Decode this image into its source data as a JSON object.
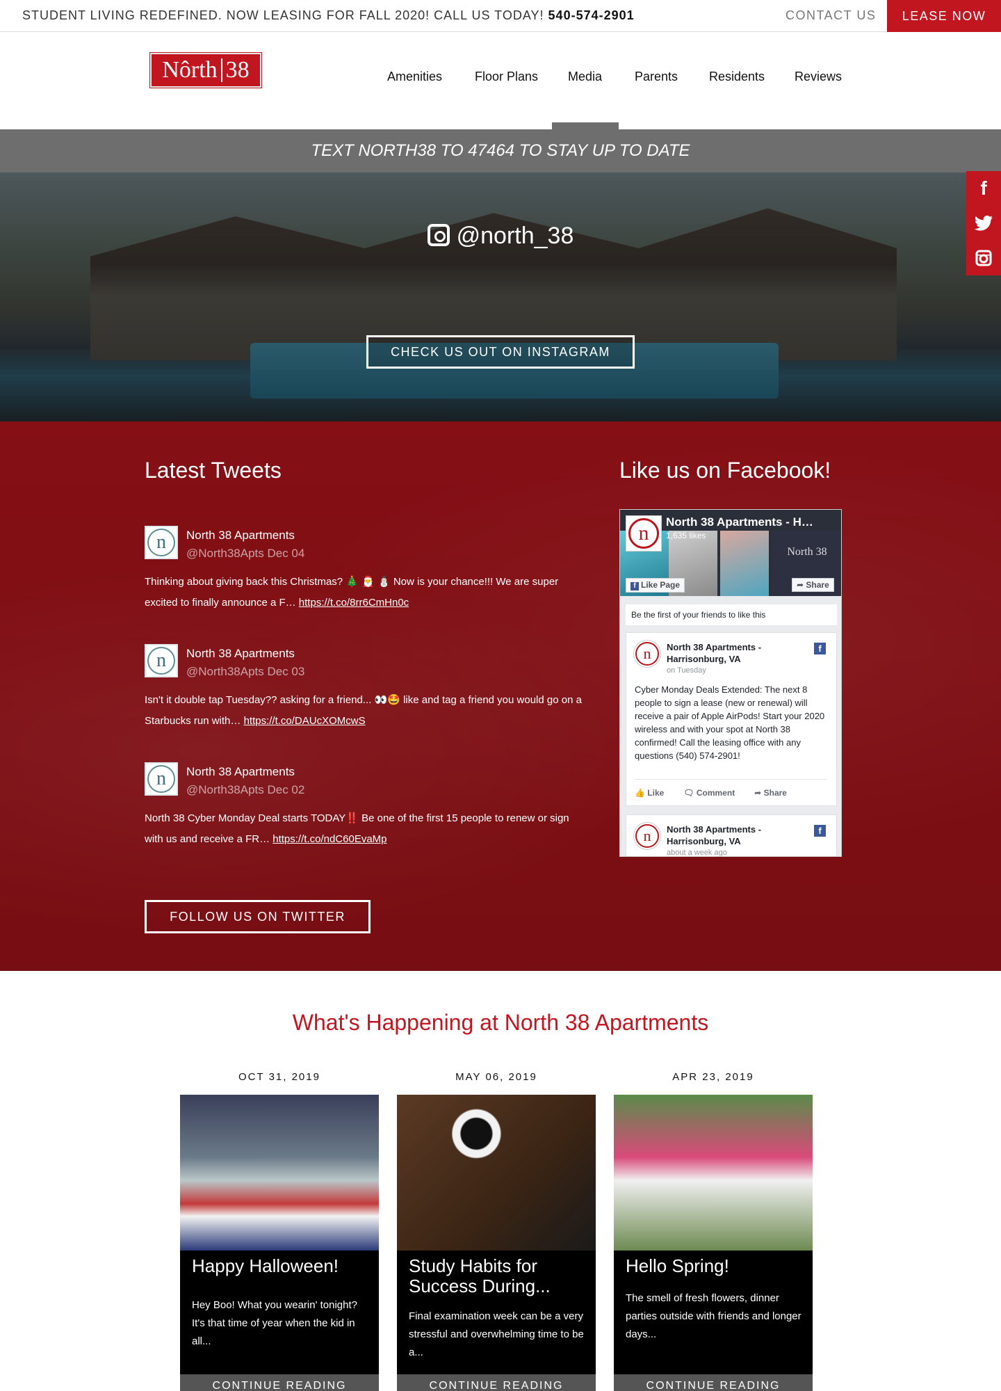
{
  "topbar": {
    "promo": "STUDENT LIVING REDEFINED. NOW LEASING FOR FALL 2020! CALL US TODAY!",
    "phone": "540-574-2901",
    "contact": "CONTACT US",
    "lease": "LEASE NOW"
  },
  "logo": {
    "left": "Nôrth",
    "right": "38"
  },
  "nav": [
    "Amenities",
    "Floor Plans",
    "Media",
    "Parents",
    "Residents",
    "Reviews"
  ],
  "textbar": "TEXT NORTH38 TO 47464 TO STAY UP TO DATE",
  "social": {
    "facebook": "f",
    "twitter": "❧",
    "instagram": "▣"
  },
  "instagram": {
    "handle": "@north_38",
    "button": "CHECK US OUT ON INSTAGRAM"
  },
  "tweets_section": {
    "title": "Latest Tweets",
    "follow": "FOLLOW US ON TWITTER",
    "items": [
      {
        "name": "North 38 Apartments",
        "handle": "@North38Apts Dec 04",
        "text": "Thinking about giving back this Christmas? 🎄 🎅 ⛄ Now is your chance!!! We are super excited to finally announce a F… ",
        "link": "https://t.co/8rr6CmHn0c"
      },
      {
        "name": "North 38 Apartments",
        "handle": "@North38Apts Dec 03",
        "text": "Isn't it double tap Tuesday?? asking for a friend... 👀🤩 like and tag a friend you would go on a Starbucks run with… ",
        "link": "https://t.co/DAUcXOMcwS"
      },
      {
        "name": "North 38 Apartments",
        "handle": "@North38Apts Dec 02",
        "text": "North 38 Cyber Monday Deal starts TODAY‼️ Be one of the first 15 people to renew or sign with us and receive a FR… ",
        "link": "https://t.co/ndC60EvaMp"
      }
    ]
  },
  "facebook": {
    "title": "Like us on Facebook!",
    "page_name": "North 38 Apartments - H…",
    "likes": "1,635 likes",
    "cover_text": "North 38",
    "like_page": "Like Page",
    "share": "Share",
    "friends": "Be the first of your friends to like this",
    "posts": [
      {
        "title": "North 38 Apartments - Harrisonburg, VA",
        "time": "on Tuesday",
        "text": "Cyber Monday Deals Extended: The next 8 people to sign a lease (new or renewal) will receive a pair of Apple AirPods! Start your 2020 wireless and with your spot at North 38 confirmed! Call the leasing office with any questions (540) 574-2901!",
        "actions": [
          "Like",
          "Comment",
          "Share"
        ]
      },
      {
        "title": "North 38 Apartments - Harrisonburg, VA",
        "time": "about a week ago"
      }
    ]
  },
  "happening": {
    "title": "What's Happening at North 38 Apartments",
    "cards": [
      {
        "date": "OCT 31, 2019",
        "title": "Happy Halloween!",
        "desc": "Hey Boo! What you wearin' tonight? It's that time of year when the kid in all...",
        "more": "CONTINUE READING"
      },
      {
        "date": "MAY 06, 2019",
        "title": "Study Habits for Success During...",
        "desc": "Final examination week can be a very stressful and overwhelming time to be a...",
        "more": "CONTINUE READING"
      },
      {
        "date": "APR 23, 2019",
        "title": "Hello Spring!",
        "desc": "The smell of fresh flowers, dinner parties outside with friends and longer days...",
        "more": "CONTINUE READING"
      }
    ]
  },
  "colors": {
    "brand_red": "#c1161f",
    "section_red": "#8c1016",
    "banner_gray": "#6e6e6e"
  }
}
